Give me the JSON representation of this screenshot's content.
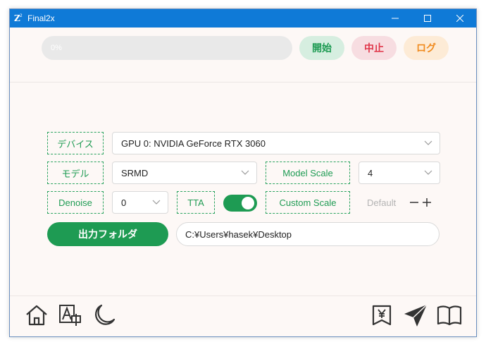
{
  "window": {
    "title": "Final2x",
    "accent": "#0f7ad7"
  },
  "toolbar": {
    "progress_label": "0%",
    "progress_fraction": 0,
    "start_label": "開始",
    "stop_label": "中止",
    "log_label": "ログ"
  },
  "settings": {
    "device_label": "デバイス",
    "device_value": "GPU 0: NVIDIA GeForce RTX 3060",
    "model_label": "モデル",
    "model_value": "SRMD",
    "model_scale_label": "Model Scale",
    "model_scale_value": "4",
    "denoise_label": "Denoise",
    "denoise_value": "0",
    "tta_label": "TTA",
    "tta_enabled": true,
    "custom_scale_label": "Custom Scale",
    "custom_scale_placeholder": "Default",
    "output_folder_label": "出力フォルダ",
    "output_path": "C:¥Users¥hasek¥Desktop"
  },
  "bottom_bar": {
    "icons": [
      "home-icon",
      "translate-icon",
      "moon-icon",
      "yen-bookmark-icon",
      "send-icon",
      "book-icon"
    ]
  },
  "colors": {
    "green": "#1e9b53",
    "red": "#e0364a",
    "orange": "#f08a1d"
  }
}
